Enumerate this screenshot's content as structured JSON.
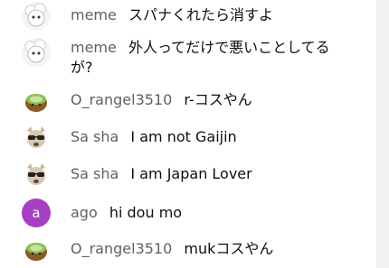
{
  "messages": [
    {
      "author": "meme",
      "text": "スパナくれたら消すよ",
      "avatar": "white-fluffy-avatar"
    },
    {
      "author": "meme",
      "text": "外人ってだけで悪いことしてるが?",
      "avatar": "white-fluffy-avatar"
    },
    {
      "author": "O_rangel3510",
      "text": "r-コスやん",
      "avatar": "kiwi-avatar"
    },
    {
      "author": "Sa sha",
      "text": "I am not Gaijin",
      "avatar": "dog-sunglasses-avatar"
    },
    {
      "author": "Sa sha",
      "text": "I am Japan Lover",
      "avatar": "dog-sunglasses-avatar"
    },
    {
      "author": "ago",
      "text": "hi dou mo",
      "avatar": "letter-avatar",
      "avatar_letter": "a",
      "avatar_color": "#a63fc4"
    },
    {
      "author": "O_rangel3510",
      "text": "mukコスやん",
      "avatar": "kiwi-avatar"
    }
  ]
}
